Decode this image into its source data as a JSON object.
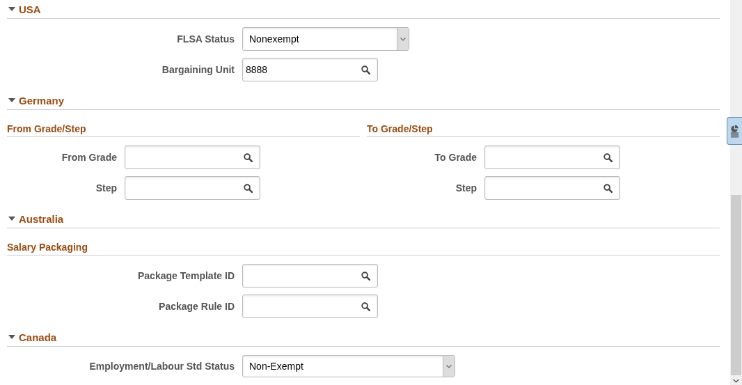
{
  "sections": [
    {
      "title": "USA",
      "expanded": true,
      "groups": [
        {
          "fields": [
            {
              "kind": "select",
              "label": "FLSA Status",
              "value": "Nonexempt"
            },
            {
              "kind": "lookup",
              "label": "Bargaining Unit",
              "value": "8888"
            }
          ]
        }
      ]
    },
    {
      "title": "Germany",
      "expanded": true,
      "groups": [
        {
          "title": "From Grade/Step",
          "fields": [
            {
              "kind": "lookup",
              "label": "From Grade"
            },
            {
              "kind": "lookup",
              "label": "Step"
            }
          ]
        },
        {
          "title": "To Grade/Step",
          "fields": [
            {
              "kind": "lookup",
              "label": "To Grade"
            },
            {
              "kind": "lookup",
              "label": "Step"
            }
          ]
        }
      ]
    },
    {
      "title": "Australia",
      "expanded": true,
      "groups": [
        {
          "title": "Salary Packaging",
          "fields": [
            {
              "kind": "lookup",
              "label": "Package Template ID"
            },
            {
              "kind": "lookup",
              "label": "Package Rule ID"
            }
          ]
        }
      ]
    },
    {
      "title": "Canada",
      "expanded": true,
      "groups": [
        {
          "fields": [
            {
              "kind": "select",
              "label": "Employment/Labour Std Status",
              "value": "Non-Exempt"
            }
          ]
        }
      ]
    }
  ]
}
